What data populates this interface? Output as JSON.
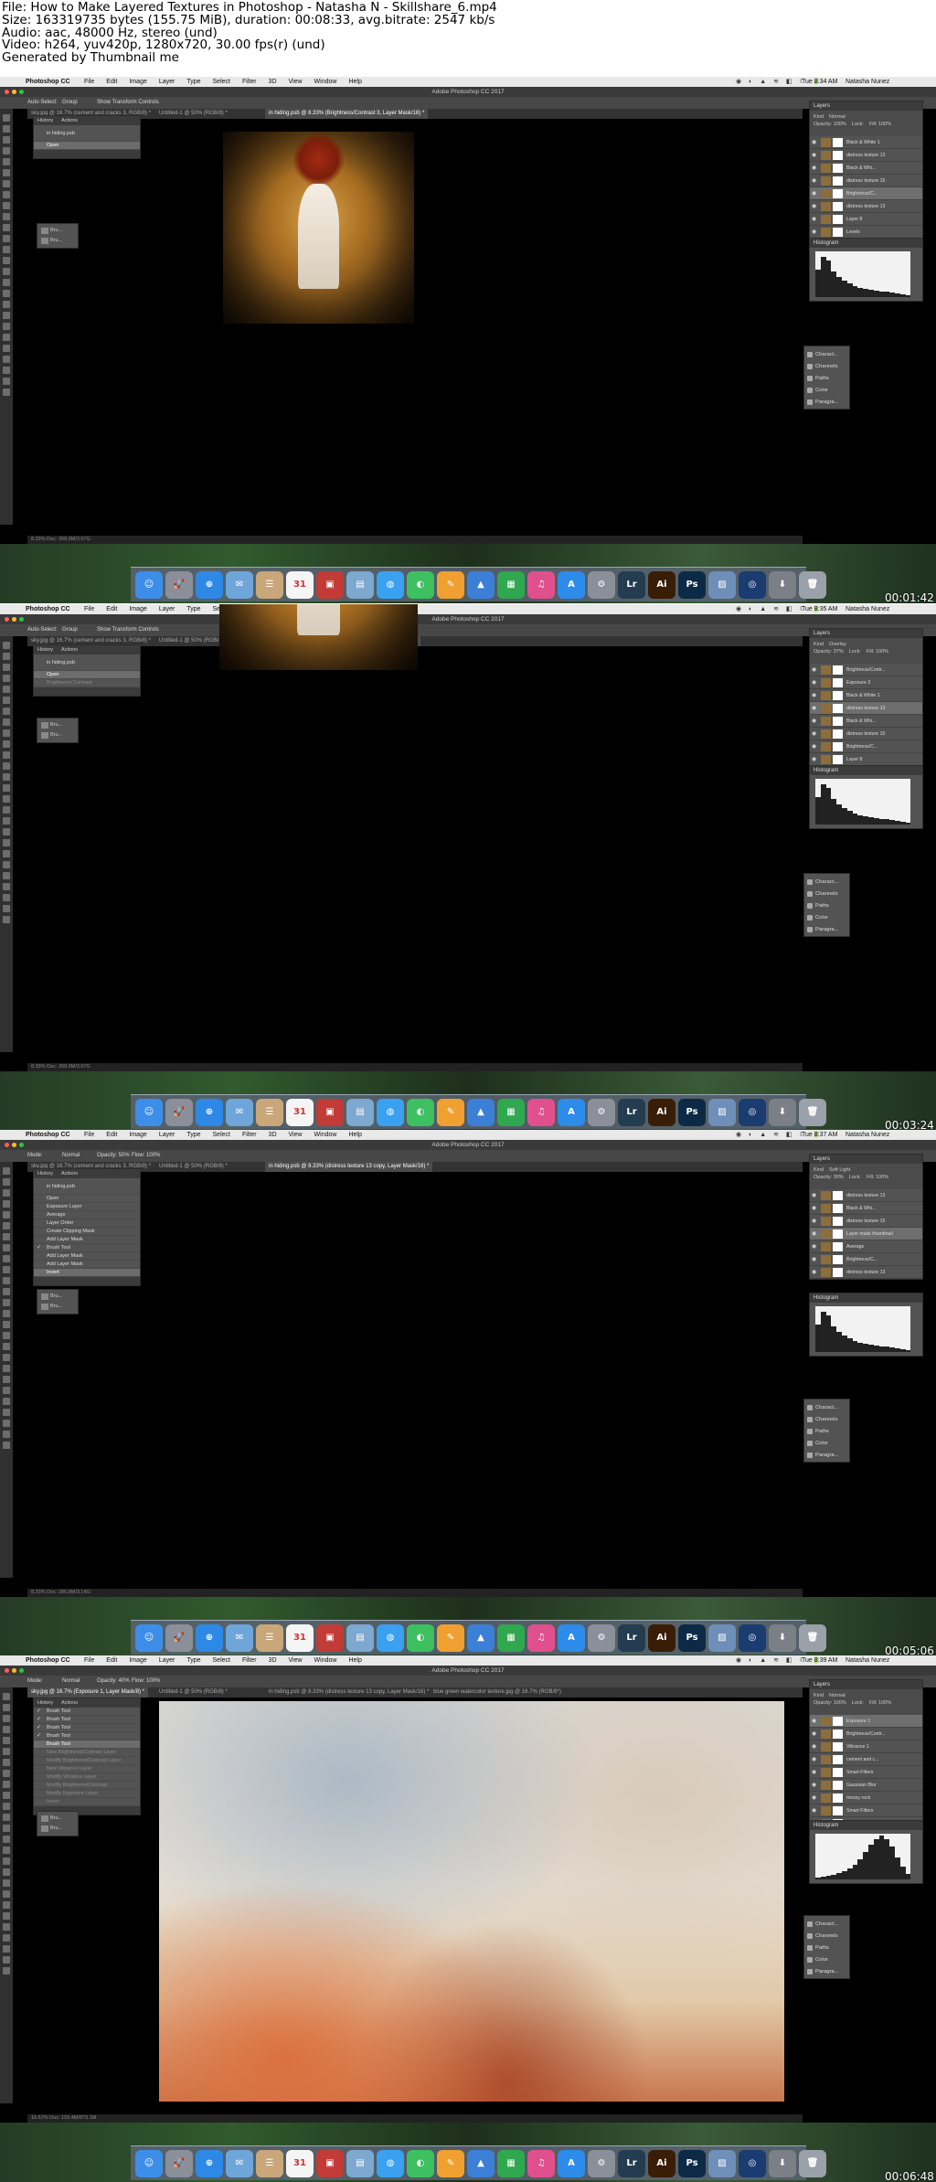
{
  "header_lines": [
    "File: How to Make Layered Textures in Photoshop - Natasha N - Skillshare_6.mp4",
    "Size: 163319735 bytes (155.75 MiB), duration: 00:08:33, avg.bitrate: 2547 kb/s",
    "Audio: aac, 48000 Hz, stereo (und)",
    "Video: h264, yuv420p, 1280x720, 30.00 fps(r) (und)",
    "Generated by Thumbnail me"
  ],
  "app": {
    "apple": "",
    "name": "Photoshop CC",
    "menus": [
      "File",
      "Edit",
      "Image",
      "Layer",
      "Type",
      "Select",
      "Filter",
      "3D",
      "View",
      "Window",
      "Help"
    ],
    "window_title": "Adobe Photoshop CC 2017",
    "user": "Natasha Nunez",
    "status_icons": "◉ ◐ ▲ ≋ ◧ ☾ 🔋"
  },
  "colors": {
    "close": "#ff5f57",
    "min": "#febc2e",
    "max": "#28c840",
    "panel": "#535353",
    "chrome": "#3a3a3a"
  },
  "frames": [
    {
      "clock": "Tue 8:34 AM",
      "timestamp": "00:01:42",
      "options": [
        "Auto-Select:",
        "Group",
        "Show Transform Controls"
      ],
      "tabs": [
        "sky.jpg @ 16.7% (cement and cracks 3, RGB/8) *",
        "Untitled-1 @ 50% (RGB/8) *",
        "in hiding.psb @ 8.33% (Brightness/Contrast 3, Layer Mask/16) *"
      ],
      "active_tab": 2,
      "status": "8.33%     Doc: 268.9M/3.07G",
      "history_tabs": [
        "History",
        "Actions"
      ],
      "history": [
        {
          "label": "in hiding.psb",
          "kind": "thumb"
        },
        {
          "label": "Open",
          "kind": "sel"
        }
      ],
      "mini": [
        "Bru...",
        "Bru..."
      ],
      "layers_header": "Layers",
      "layers_ctl": [
        "Kind",
        "Normal",
        "Opacity: 100%",
        "Lock:",
        "Fill: 100%"
      ],
      "layers": [
        {
          "name": "Black & White 1",
          "sel": false
        },
        {
          "name": "distress texture 13",
          "sel": false
        },
        {
          "name": "Black & Whi...",
          "sel": false
        },
        {
          "name": "distress texture 15",
          "sel": false
        },
        {
          "name": "Brightness/C...",
          "sel": true
        },
        {
          "name": "distress texture 13",
          "sel": false
        },
        {
          "name": "Layer 8",
          "sel": false
        },
        {
          "name": "Levels",
          "sel": false
        }
      ],
      "histogram_header": "Histogram",
      "side_items": [
        "Charact...",
        "Channels",
        "Paths",
        "Color",
        "Paragra..."
      ]
    },
    {
      "clock": "Tue 8:35 AM",
      "timestamp": "00:03:24",
      "options": [
        "Auto-Select:",
        "Group",
        "Show Transform Controls"
      ],
      "tabs": [
        "sky.jpg @ 16.7% (cement and cracks 3, RGB/8) *",
        "Untitled-1 @ 50% (RGB/8) *",
        "in hiding.psb @ 8.33% (distress texture 13, Layer Mask/16) *"
      ],
      "active_tab": 2,
      "status": "8.33%     Doc: 268.9M/3.07G",
      "history_tabs": [
        "History",
        "Actions"
      ],
      "history": [
        {
          "label": "in hiding.psb",
          "kind": "thumb"
        },
        {
          "label": "Open",
          "kind": "sel"
        },
        {
          "label": "Brightness/ Contrast",
          "kind": "dim"
        }
      ],
      "mini": [
        "Bru...",
        "Bru..."
      ],
      "layers_header": "Layers",
      "layers_ctl": [
        "Kind",
        "Overlay",
        "Opacity: 37%",
        "Lock:",
        "Fill: 100%"
      ],
      "layers": [
        {
          "name": "Brightness/Contr...",
          "sel": false
        },
        {
          "name": "Exposure 3",
          "sel": false
        },
        {
          "name": "Black & White 1",
          "sel": false
        },
        {
          "name": "distress texture 13",
          "sel": true
        },
        {
          "name": "Black & Whi...",
          "sel": false
        },
        {
          "name": "distress texture 15",
          "sel": false
        },
        {
          "name": "Brightness/C...",
          "sel": false
        },
        {
          "name": "Layer 8",
          "sel": false
        }
      ],
      "histogram_header": "Histogram",
      "side_items": [
        "Charact...",
        "Channels",
        "Paths",
        "Color",
        "Paragra..."
      ]
    },
    {
      "clock": "Tue 8:37 AM",
      "timestamp": "00:05:06",
      "options": [
        "Mode:",
        "Normal",
        "Opacity: 50%",
        "Flow: 100%"
      ],
      "tabs": [
        "sky.jpg @ 16.7% (cement and cracks 3, RGB/8) *",
        "Untitled-1 @ 50% (RGB/8) *",
        "in hiding.psb @ 8.33% (distress texture 13 copy, Layer Mask/16) *"
      ],
      "active_tab": 2,
      "status": "8.33%     Doc: 286.8M/3.14G",
      "history_tabs": [
        "History",
        "Actions"
      ],
      "history": [
        {
          "label": "in hiding.psb",
          "kind": "thumb"
        },
        {
          "label": "Open",
          "kind": ""
        },
        {
          "label": "Exposure Layer",
          "kind": ""
        },
        {
          "label": "Average",
          "kind": ""
        },
        {
          "label": "Layer Order",
          "kind": ""
        },
        {
          "label": "Create Clipping Mask",
          "kind": ""
        },
        {
          "label": "Add Layer Mask",
          "kind": ""
        },
        {
          "label": "Brush Tool",
          "kind": "chk"
        },
        {
          "label": "Add Layer Mask",
          "kind": ""
        },
        {
          "label": "Add Layer Mask",
          "kind": ""
        },
        {
          "label": "Invert",
          "kind": "sel"
        }
      ],
      "mini": [
        "Bru...",
        "Bru..."
      ],
      "layers_header": "Layers",
      "layers_ctl": [
        "Kind",
        "Soft Light",
        "Opacity: 30%",
        "Lock:",
        "Fill: 100%"
      ],
      "layers": [
        {
          "name": "distress texture 13",
          "sel": false
        },
        {
          "name": "Black & Whi...",
          "sel": false
        },
        {
          "name": "distress texture 15",
          "sel": false
        },
        {
          "name": "Layer mask thumbnail",
          "sel": true
        },
        {
          "name": "Average",
          "sel": false
        },
        {
          "name": "Brightness/C...",
          "sel": false
        },
        {
          "name": "distress texture 13",
          "sel": false
        }
      ],
      "histogram_header": "Histogram",
      "side_items": [
        "Charact...",
        "Channels",
        "Paths",
        "Color",
        "Paragra..."
      ]
    },
    {
      "clock": "Tue 8:39 AM",
      "timestamp": "00:06:48",
      "options": [
        "Mode:",
        "Normal",
        "Opacity: 40%",
        "Flow: 100%"
      ],
      "tabs": [
        "sky.jpg @ 16.7% (Exposure 1, Layer Mask/8) *",
        "Untitled-1 @ 50% (RGB/8) *",
        "in hiding.psb @ 8.33% (distress texture 13 copy, Layer Mask/16) *",
        "blue green watercolor texture.jpg @ 16.7% (RGB/8*)"
      ],
      "active_tab": 0,
      "status": "16.67%     Doc: 103.4M/873.1M",
      "history_tabs": [
        "History",
        "Actions"
      ],
      "history": [
        {
          "label": "Brush Tool",
          "kind": "chk"
        },
        {
          "label": "Brush Tool",
          "kind": "chk"
        },
        {
          "label": "Brush Tool",
          "kind": "chk"
        },
        {
          "label": "Brush Tool",
          "kind": "chk"
        },
        {
          "label": "Brush Tool",
          "kind": "sel"
        },
        {
          "label": "New Brightness/Contrast Layer",
          "kind": "dim"
        },
        {
          "label": "Modify Brightness/Contrast Layer",
          "kind": "dim"
        },
        {
          "label": "New Vibrance Layer",
          "kind": "dim"
        },
        {
          "label": "Modify Vibrance Layer",
          "kind": "dim"
        },
        {
          "label": "Modify Brightness/Contrast",
          "kind": "dim"
        },
        {
          "label": "Modify Exposure Layer",
          "kind": "dim"
        },
        {
          "label": "Invert",
          "kind": "dim"
        }
      ],
      "mini": [
        "Bru...",
        "Bru..."
      ],
      "layers_header": "Layers",
      "layers_ctl": [
        "Kind",
        "Normal",
        "Opacity: 100%",
        "Lock:",
        "Fill: 100%"
      ],
      "layers": [
        {
          "name": "Exposure 1",
          "sel": true
        },
        {
          "name": "Brightness/Contr...",
          "sel": false
        },
        {
          "name": "Vibrance 1",
          "sel": false
        },
        {
          "name": "cement and c...",
          "sel": false
        },
        {
          "name": "Smart Filters",
          "sel": false
        },
        {
          "name": "Gaussian Blur",
          "sel": false
        },
        {
          "name": "mossy rock",
          "sel": false
        },
        {
          "name": "Smart Filters",
          "sel": false
        },
        {
          "name": "Gaussian Blur",
          "sel": false
        },
        {
          "name": "Layer 0",
          "sel": false
        }
      ],
      "histogram_header": "Histogram",
      "side_items": [
        "Charact...",
        "Channels",
        "Paths",
        "Color",
        "Paragra..."
      ]
    }
  ],
  "dock": [
    {
      "icon": "finder-icon",
      "label": "☺",
      "color": "#3d8ee8"
    },
    {
      "icon": "launchpad-icon",
      "label": "🚀",
      "color": "#8a8f99"
    },
    {
      "icon": "safari-icon",
      "label": "⊕",
      "color": "#2d89e5"
    },
    {
      "icon": "mail-icon",
      "label": "✉",
      "color": "#6fa6d9"
    },
    {
      "icon": "contacts-icon",
      "label": "☰",
      "color": "#c9a77a"
    },
    {
      "icon": "calendar-icon",
      "label": "31",
      "color": "#f5f5f5"
    },
    {
      "icon": "photo-booth-icon",
      "label": "▣",
      "color": "#c23b36"
    },
    {
      "icon": "preview-icon",
      "label": "▤",
      "color": "#7da8cf"
    },
    {
      "icon": "messages-icon",
      "label": "◍",
      "color": "#3aa0f0"
    },
    {
      "icon": "facetime-icon",
      "label": "◐",
      "color": "#3cc060"
    },
    {
      "icon": "ibooks-icon",
      "label": "✎",
      "color": "#f0a030"
    },
    {
      "icon": "keynote-icon",
      "label": "▲",
      "color": "#3b7fd6"
    },
    {
      "icon": "numbers-icon",
      "label": "▦",
      "color": "#2fa84f"
    },
    {
      "icon": "itunes-icon",
      "label": "♫",
      "color": "#e0508c"
    },
    {
      "icon": "app-store-icon",
      "label": "A",
      "color": "#2d8bea"
    },
    {
      "icon": "system-preferences-icon",
      "label": "⚙",
      "color": "#8a8f99"
    },
    {
      "icon": "lightroom-icon",
      "label": "Lr",
      "color": "#233c50"
    },
    {
      "icon": "illustrator-icon",
      "label": "Ai",
      "color": "#3a1d07"
    },
    {
      "icon": "photoshop-icon",
      "label": "Ps",
      "color": "#0c2a45"
    },
    {
      "icon": "photos-icon",
      "label": "▨",
      "color": "#6e8fb8"
    },
    {
      "icon": "quicktime-icon",
      "label": "◎",
      "color": "#1a3c70"
    },
    {
      "icon": "downloads-icon",
      "label": "⬇",
      "color": "#7b7f86"
    },
    {
      "icon": "trash-icon",
      "label": "🗑",
      "color": "#9aa1a8"
    }
  ]
}
